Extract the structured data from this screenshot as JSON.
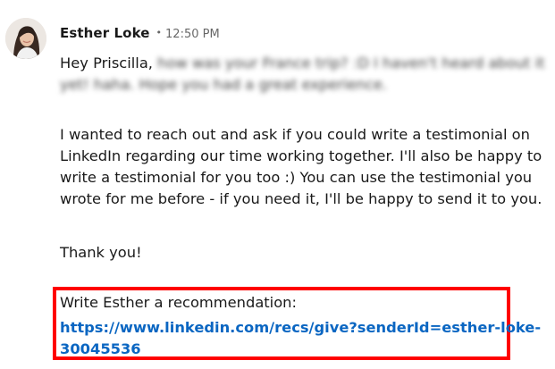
{
  "message": {
    "sender": "Esther Loke",
    "separator": "•",
    "time": "12:50 PM",
    "greeting": "Hey Priscilla,",
    "blurred_line1": "how was your France trip? :D I haven't heard about it",
    "blurred_line2": "yet! haha. Hope you had a great experience.",
    "paragraph_lines": [
      "I wanted to reach out and ask if you could write a testimonial on",
      "LinkedIn regarding our time working together. I'll also be happy to",
      "write a testimonial for you too :) You can use the testimonial you",
      "wrote for me before - if you need it, I'll be happy to send it to you."
    ],
    "thanks": "Thank you!",
    "recommendation_label": "Write Esther a recommendation:",
    "recommendation_link_lines": [
      "https://www.linkedin.com/recs/give?senderId=esther-loke-",
      "30045536"
    ]
  },
  "colors": {
    "link": "#0a66c2",
    "highlight_box": "#ff0000"
  },
  "icons": {
    "avatar": "profile-photo"
  }
}
